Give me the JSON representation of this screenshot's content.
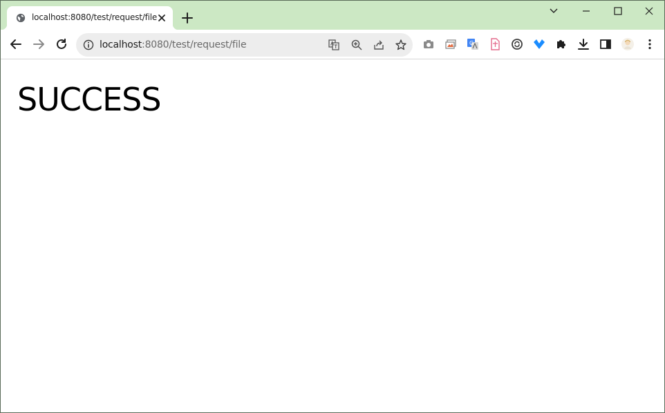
{
  "tab": {
    "title": "localhost:8080/test/request/file",
    "favicon": "globe-icon"
  },
  "address_bar": {
    "host": "localhost",
    "path": ":8080/test/request/file"
  },
  "page": {
    "heading": "SUCCESS"
  },
  "colors": {
    "tabstrip_bg": "#cce8c4",
    "omnibox_bg": "#ededed",
    "icon": "#3c3c3c"
  }
}
